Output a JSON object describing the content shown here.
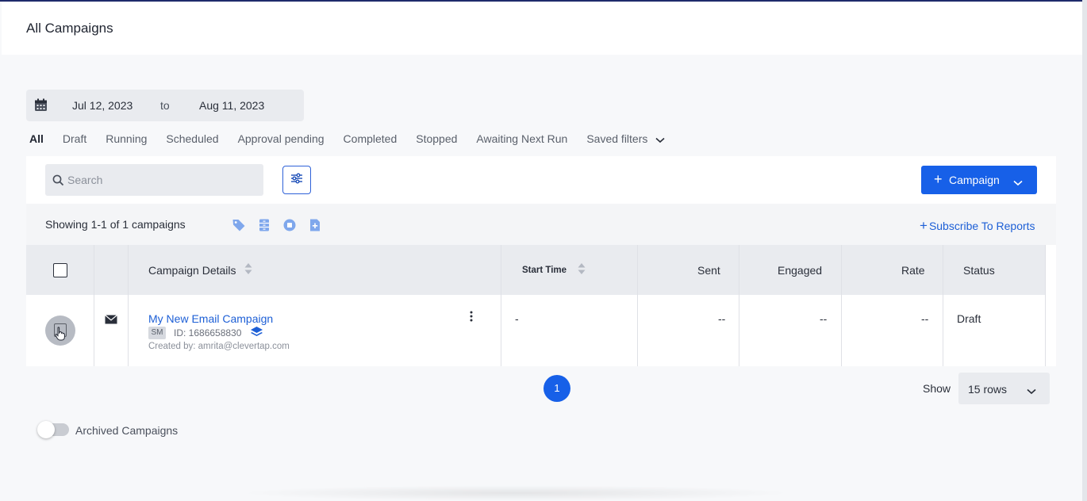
{
  "page": {
    "title": "All Campaigns"
  },
  "date_range": {
    "start": "Jul 12, 2023",
    "separator": "to",
    "end": "Aug 11, 2023"
  },
  "tabs": [
    {
      "label": "All",
      "active": true
    },
    {
      "label": "Draft"
    },
    {
      "label": "Running"
    },
    {
      "label": "Scheduled"
    },
    {
      "label": "Approval pending"
    },
    {
      "label": "Completed"
    },
    {
      "label": "Stopped"
    },
    {
      "label": "Awaiting Next Run"
    },
    {
      "label": "Saved filters"
    }
  ],
  "toolbar": {
    "search_placeholder": "Search",
    "campaign_button_label": "Campaign"
  },
  "info": {
    "showing_text": "Showing 1-1 of 1 campaigns",
    "subscribe_label": "Subscribe To Reports"
  },
  "table": {
    "headers": {
      "details": "Campaign Details",
      "start_time": "Start Time",
      "sent": "Sent",
      "engaged": "Engaged",
      "rate": "Rate",
      "status": "Status"
    },
    "rows": [
      {
        "name": "My New Email Campaign",
        "badge": "SM",
        "id_text": "ID: 1686658830",
        "created_by": "Created by: amrita@clevertap.com",
        "start_time": "-",
        "sent": "--",
        "engaged": "--",
        "rate": "--",
        "status": "Draft"
      }
    ]
  },
  "pagination": {
    "current_page": "1",
    "show_label": "Show",
    "rows_option": "15 rows"
  },
  "archived": {
    "label": "Archived Campaigns",
    "enabled": false
  },
  "colors": {
    "primary": "#1760e8",
    "link": "#1d5fd6",
    "header_bg": "#e9ebef"
  }
}
